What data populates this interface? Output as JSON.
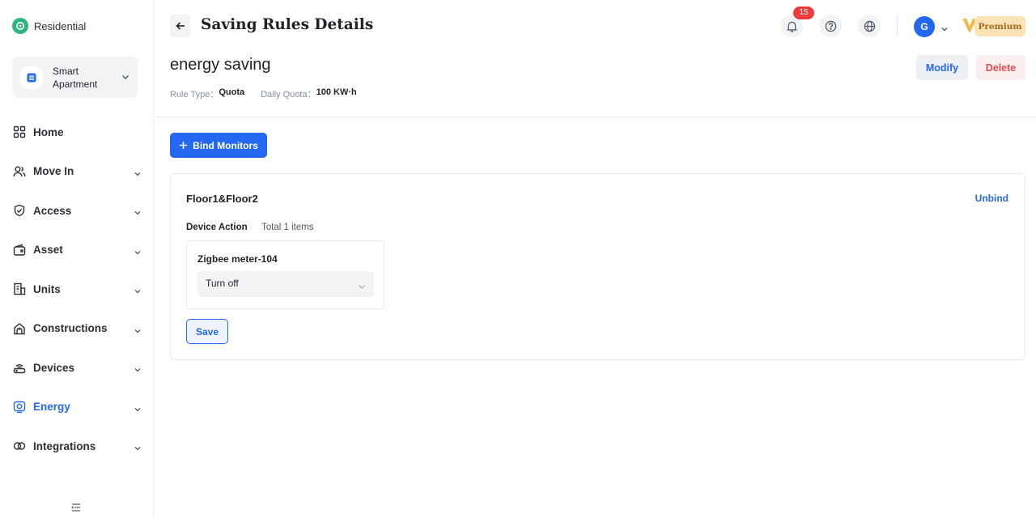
{
  "sidebar": {
    "brand": "Residential",
    "project": "Smart Apartment",
    "items": [
      {
        "label": "Home",
        "icon": "grid-icon"
      },
      {
        "label": "Move In",
        "icon": "users-icon"
      },
      {
        "label": "Access",
        "icon": "shield-icon"
      },
      {
        "label": "Asset",
        "icon": "wallet-icon"
      },
      {
        "label": "Units",
        "icon": "building-icon"
      },
      {
        "label": "Constructions",
        "icon": "hardhat-icon"
      },
      {
        "label": "Devices",
        "icon": "router-icon"
      },
      {
        "label": "Energy",
        "icon": "energy-icon"
      },
      {
        "label": "Integrations",
        "icon": "puzzle-icon"
      }
    ]
  },
  "header": {
    "title": "Saving Rules Details",
    "notification_count": "15",
    "avatar_initial": "G",
    "premium_label": "Premium"
  },
  "rule": {
    "name": "energy saving",
    "type_label": "Rule Type：",
    "type_value": "Quota",
    "quota_label": "Daily Quota：",
    "quota_value": "100 KW·h",
    "modify_label": "Modify",
    "delete_label": "Delete"
  },
  "bind_monitors_label": "Bind Monitors",
  "group": {
    "name": "Floor1&Floor2",
    "unbind_label": "Unbind",
    "device_action_label": "Device Action",
    "total_label": "Total 1 items",
    "device": {
      "name": "Zigbee meter-104",
      "action": "Turn off"
    },
    "save_label": "Save"
  },
  "colors": {
    "accent": "#2468f2",
    "danger": "#e34d4d",
    "brand": "#2fb57f",
    "premium": "#fbe3b5"
  }
}
